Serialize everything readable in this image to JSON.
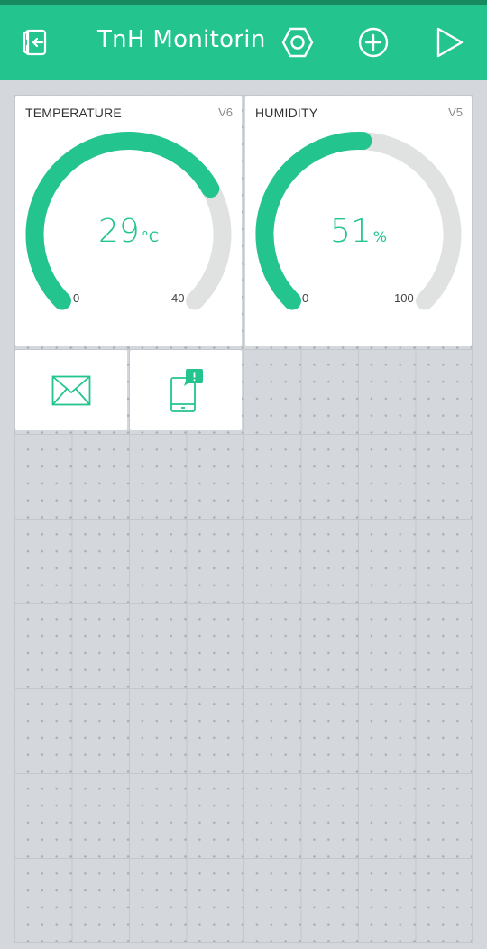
{
  "app": {
    "title": "TnH Monitorin",
    "accent_color": "#23c48e",
    "icons": [
      "exit-icon",
      "device-settings-icon",
      "add-widget-icon",
      "play-icon"
    ]
  },
  "widgets": {
    "temperature": {
      "label": "TEMPERATURE",
      "pin": "V6",
      "value": "29",
      "unit": "°C",
      "min": "0",
      "max": "40",
      "fraction": 0.725
    },
    "humidity": {
      "label": "HUMIDITY",
      "pin": "V5",
      "value": "51",
      "unit": "%",
      "min": "0",
      "max": "100",
      "fraction": 0.51
    },
    "email": {
      "icon": "email-icon"
    },
    "notification": {
      "icon": "push-notification-icon"
    }
  }
}
